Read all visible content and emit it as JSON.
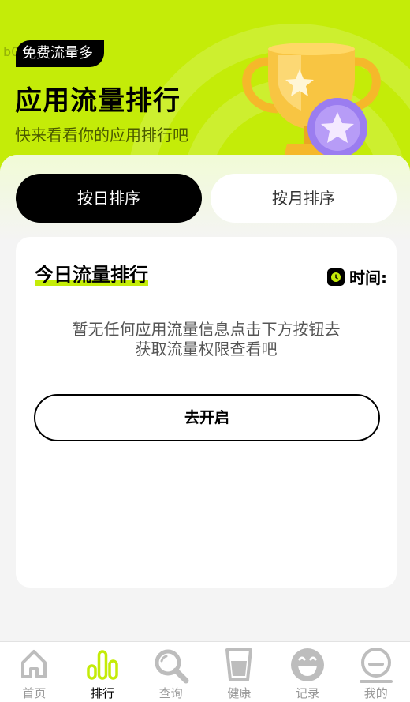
{
  "header": {
    "watermark": "b0",
    "badge": "免费流量多",
    "title": "应用流量排行",
    "subtitle": "快来看看你的应用排行吧"
  },
  "tabs": [
    {
      "label": "按日排序",
      "selected": true
    },
    {
      "label": "按月排序",
      "selected": false
    }
  ],
  "card": {
    "title": "今日流量排行",
    "time_label": "时间:",
    "empty_line1": "暂无任何应用流量信息点击下方按钮去",
    "empty_line2": "获取流量权限查看吧",
    "button_label": "去开启"
  },
  "nav": [
    {
      "label": "首页",
      "icon": "home-icon",
      "active": false
    },
    {
      "label": "排行",
      "icon": "bar-chart-icon",
      "active": true
    },
    {
      "label": "查询",
      "icon": "search-icon",
      "active": false
    },
    {
      "label": "健康",
      "icon": "cup-icon",
      "active": false
    },
    {
      "label": "记录",
      "icon": "smile-icon",
      "active": false
    },
    {
      "label": "我的",
      "icon": "profile-icon",
      "active": false
    }
  ],
  "colors": {
    "accent": "#c4ec08",
    "dark": "#000000",
    "inactive": "#bdbdbd"
  }
}
